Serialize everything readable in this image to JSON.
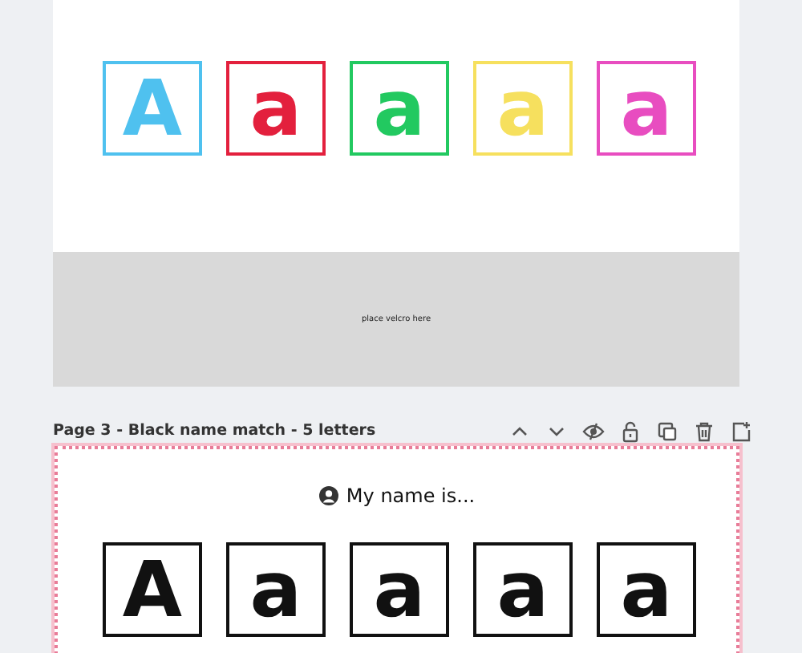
{
  "pages": [
    {
      "selected": false,
      "letters": [
        {
          "char": "A",
          "color": "#4fc1ef"
        },
        {
          "char": "a",
          "color": "#e3203d"
        },
        {
          "char": "a",
          "color": "#22c960"
        },
        {
          "char": "a",
          "color": "#f6e05e"
        },
        {
          "char": "a",
          "color": "#e84dc0"
        }
      ],
      "footer": "place velcro here"
    },
    {
      "title": "Page 3 - Black name match - 5 letters",
      "selected": true,
      "heading": "My name is...",
      "letters": [
        {
          "char": "A"
        },
        {
          "char": "a"
        },
        {
          "char": "a"
        },
        {
          "char": "a"
        },
        {
          "char": "a"
        }
      ]
    }
  ]
}
